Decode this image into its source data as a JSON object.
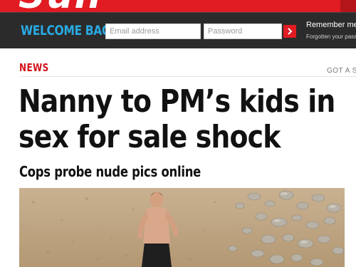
{
  "masthead": {
    "logo_text": "Sun"
  },
  "login": {
    "welcome": "WELCOME BACK",
    "email_placeholder": "Email address",
    "password_placeholder": "Password",
    "remember": "Remember me",
    "forgot": "Forgotten your pass"
  },
  "section": {
    "label": "NEWS",
    "got_story": "GOT A S"
  },
  "article": {
    "headline_line1": "Nanny to PM’s kids in",
    "headline_line2": "sex for sale shock",
    "standfirst": "Cops probe nude pics online"
  },
  "colors": {
    "brand_red": "#e11b22",
    "welcome_blue": "#29a9e1",
    "bar_dark": "#2b2b2b"
  },
  "icons": {
    "submit": "chevron-right-icon"
  }
}
